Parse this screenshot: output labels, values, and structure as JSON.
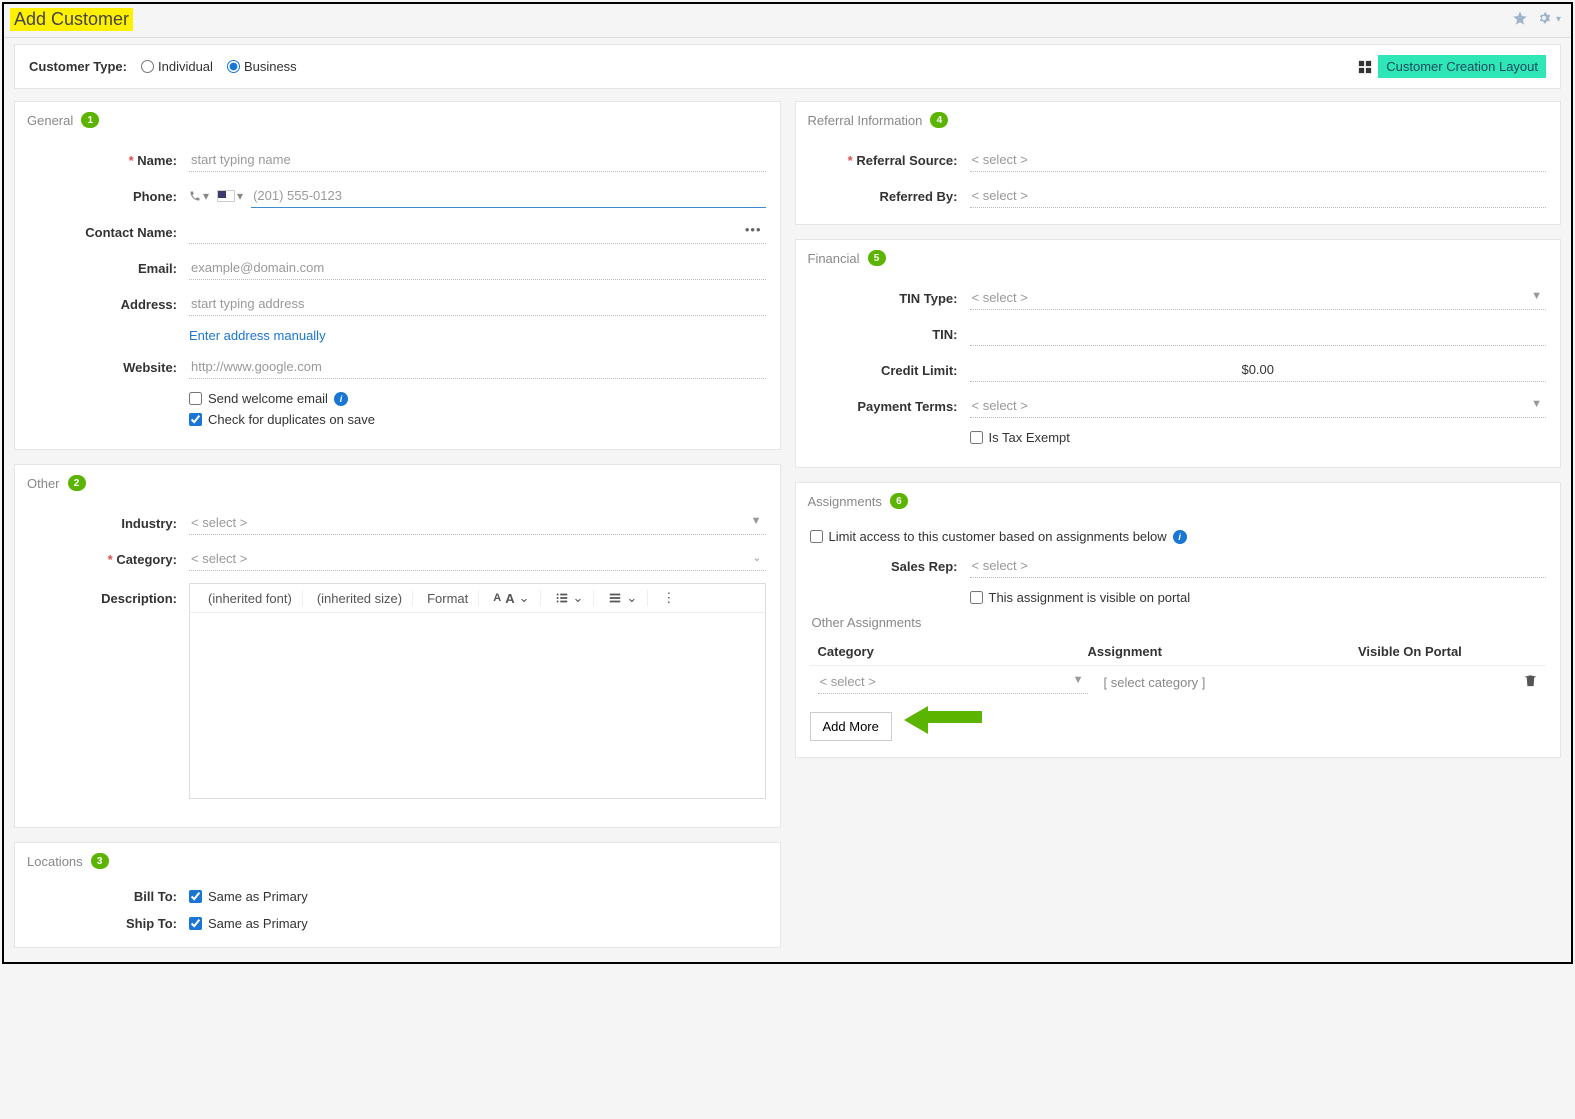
{
  "page_title": "Add Customer",
  "customer_type": {
    "label": "Customer Type:",
    "individual_label": "Individual",
    "business_label": "Business",
    "selected": "Business"
  },
  "layout_button": "Customer Creation Layout",
  "panels": {
    "general": {
      "title": "General",
      "step": "1"
    },
    "other": {
      "title": "Other",
      "step": "2"
    },
    "locations": {
      "title": "Locations",
      "step": "3"
    },
    "referral": {
      "title": "Referral Information",
      "step": "4"
    },
    "financial": {
      "title": "Financial",
      "step": "5"
    },
    "assignments": {
      "title": "Assignments",
      "step": "6"
    }
  },
  "general": {
    "name_label": "Name:",
    "name_placeholder": "start typing name",
    "phone_label": "Phone:",
    "phone_placeholder": "(201) 555-0123",
    "contact_label": "Contact Name:",
    "email_label": "Email:",
    "email_placeholder": "example@domain.com",
    "address_label": "Address:",
    "address_placeholder": "start typing address",
    "address_link": "Enter address manually",
    "website_label": "Website:",
    "website_placeholder": "http://www.google.com",
    "welcome_label": "Send welcome email",
    "dup_label": "Check for duplicates on save"
  },
  "other": {
    "industry_label": "Industry:",
    "industry_placeholder": "< select >",
    "category_label": "Category:",
    "category_placeholder": "< select >",
    "description_label": "Description:",
    "rte": {
      "font": "(inherited font)",
      "size": "(inherited size)",
      "format": "Format"
    }
  },
  "locations": {
    "billto_label": "Bill To:",
    "shipto_label": "Ship To:",
    "same_label": "Same as Primary"
  },
  "referral": {
    "source_label": "Referral Source:",
    "source_placeholder": "< select >",
    "by_label": "Referred By:",
    "by_placeholder": "< select >"
  },
  "financial": {
    "tin_type_label": "TIN Type:",
    "tin_type_placeholder": "< select >",
    "tin_label": "TIN:",
    "credit_label": "Credit Limit:",
    "credit_value": "$0.00",
    "terms_label": "Payment Terms:",
    "terms_placeholder": "< select >",
    "exempt_label": "Is Tax Exempt"
  },
  "assignments": {
    "limit_label": "Limit access to this customer based on assignments below",
    "rep_label": "Sales Rep:",
    "rep_placeholder": "< select >",
    "visible_label": "This assignment is visible on portal",
    "other_title": "Other Assignments",
    "col_cat": "Category",
    "col_assign": "Assignment",
    "col_vis": "Visible On Portal",
    "row_cat_placeholder": "< select >",
    "row_assign_placeholder": "[ select category ]",
    "add_more": "Add More"
  }
}
